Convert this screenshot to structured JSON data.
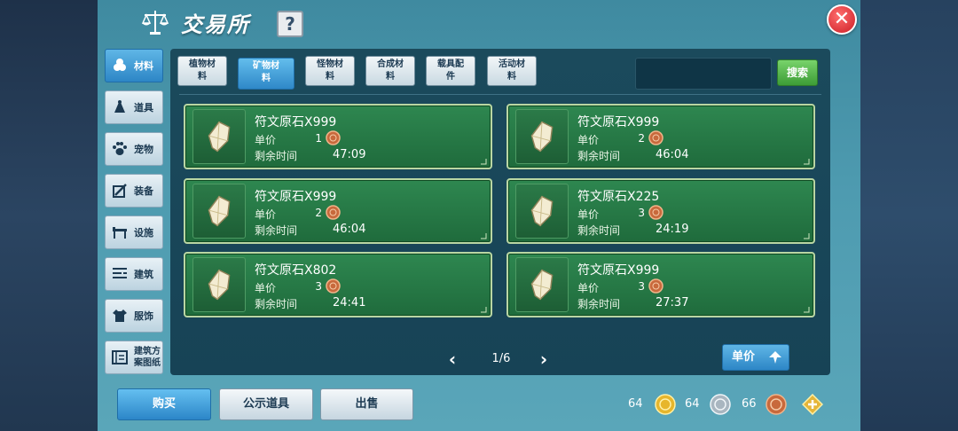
{
  "window": {
    "title": "交易所",
    "help_label": "?",
    "close_label": "✕"
  },
  "sidebar": {
    "items": [
      {
        "label": "材料",
        "icon": "materials-icon",
        "active": true
      },
      {
        "label": "道具",
        "icon": "item-icon",
        "active": false
      },
      {
        "label": "宠物",
        "icon": "paw-icon",
        "active": false
      },
      {
        "label": "装备",
        "icon": "equipment-icon",
        "active": false
      },
      {
        "label": "设施",
        "icon": "facility-icon",
        "active": false
      },
      {
        "label": "建筑",
        "icon": "building-icon",
        "active": false
      },
      {
        "label": "服饰",
        "icon": "clothing-icon",
        "active": false
      },
      {
        "label": "建筑方案图纸",
        "icon": "blueprint-icon",
        "active": false
      }
    ]
  },
  "tabs": [
    {
      "label_line1": "植物材",
      "label_line2": "料",
      "active": false
    },
    {
      "label_line1": "矿物材",
      "label_line2": "料",
      "active": true
    },
    {
      "label_line1": "怪物材",
      "label_line2": "料",
      "active": false
    },
    {
      "label_line1": "合成材",
      "label_line2": "料",
      "active": false
    },
    {
      "label_line1": "载具配",
      "label_line2": "件",
      "active": false
    },
    {
      "label_line1": "活动材",
      "label_line2": "料",
      "active": false
    }
  ],
  "search": {
    "value": "",
    "button_label": "搜索"
  },
  "listings": [
    {
      "name": "符文原石X999",
      "price_label": "单价",
      "price": "1",
      "time_label": "剩余时间",
      "time": "47:09"
    },
    {
      "name": "符文原石X999",
      "price_label": "单价",
      "price": "2",
      "time_label": "剩余时间",
      "time": "46:04"
    },
    {
      "name": "符文原石X999",
      "price_label": "单价",
      "price": "2",
      "time_label": "剩余时间",
      "time": "46:04"
    },
    {
      "name": "符文原石X225",
      "price_label": "单价",
      "price": "3",
      "time_label": "剩余时间",
      "time": "24:19"
    },
    {
      "name": "符文原石X802",
      "price_label": "单价",
      "price": "3",
      "time_label": "剩余时间",
      "time": "24:41"
    },
    {
      "name": "符文原石X999",
      "price_label": "单价",
      "price": "3",
      "time_label": "剩余时间",
      "time": "27:37"
    }
  ],
  "pager": {
    "text": "1/6"
  },
  "sort": {
    "label": "单价"
  },
  "bottom": {
    "buy_label": "购买",
    "showcase_label": "公示道具",
    "sell_label": "出售"
  },
  "currency": {
    "gold": "64",
    "silver": "64",
    "copper": "66"
  },
  "colors": {
    "accent_blue": "#2d86c6",
    "card_green": "#1f6b3c",
    "search_green": "#3d9c36",
    "close_red": "#cc1e26"
  }
}
